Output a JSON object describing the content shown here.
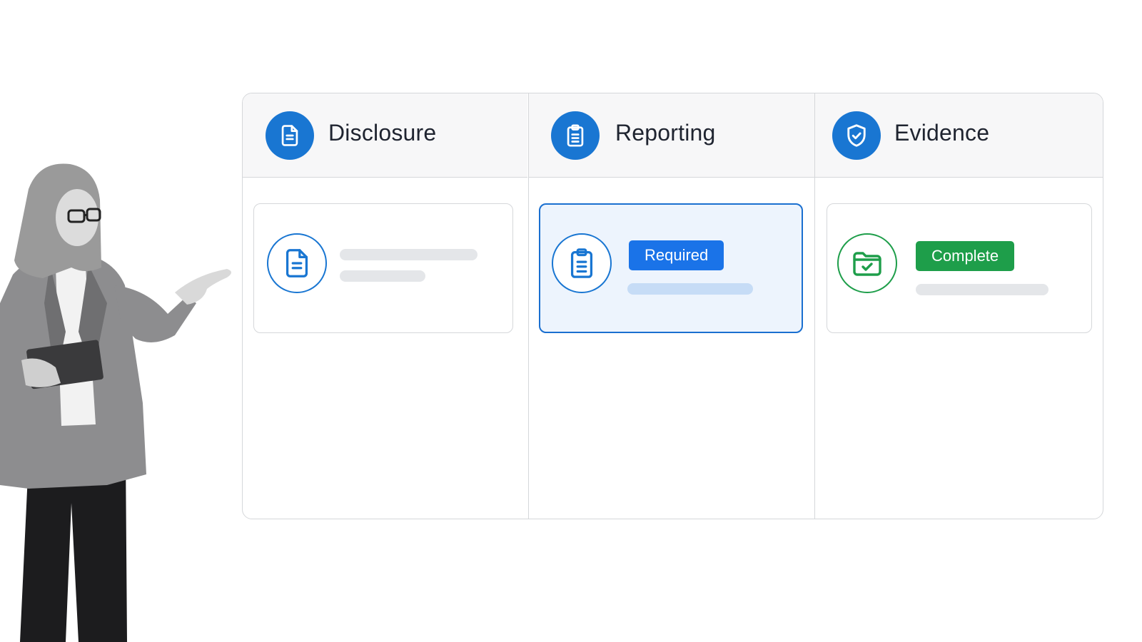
{
  "board": {
    "columns": [
      {
        "title": "Disclosure",
        "icon": "document-icon",
        "card": {
          "icon": "document-icon",
          "badge": ""
        }
      },
      {
        "title": "Reporting",
        "icon": "clipboard-icon",
        "card": {
          "icon": "clipboard-icon",
          "badge": "Required"
        }
      },
      {
        "title": "Evidence",
        "icon": "shield-check-icon",
        "card": {
          "icon": "folder-check-icon",
          "badge": "Complete"
        }
      }
    ]
  },
  "colors": {
    "accent_blue": "#1976d2",
    "required_badge": "#1a73e8",
    "complete_badge": "#1e9e4a",
    "highlight_card_bg": "#edf4fd"
  }
}
